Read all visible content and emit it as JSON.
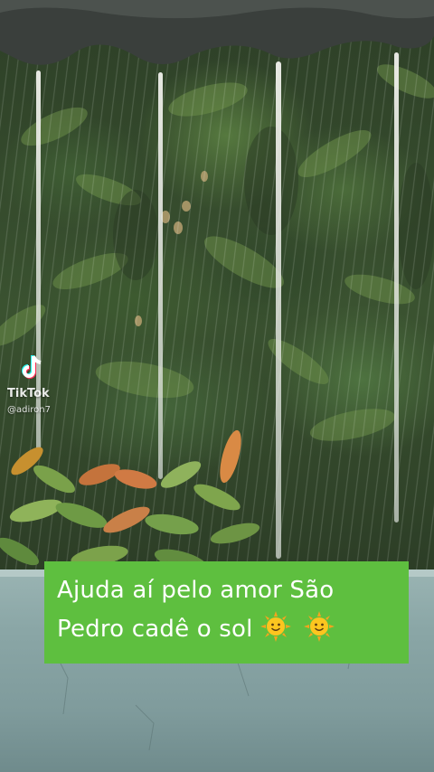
{
  "watermark": {
    "brand": "TikTok",
    "username": "@adiron7"
  },
  "caption": {
    "line1": "Ajuda aí pelo amor São",
    "line2": "Pedro cadê o sol",
    "emoji": [
      "smiling-sun-emoji",
      "smiling-sun-emoji"
    ],
    "background_color": "#5ebf3f",
    "text_color": "#ffffff"
  }
}
